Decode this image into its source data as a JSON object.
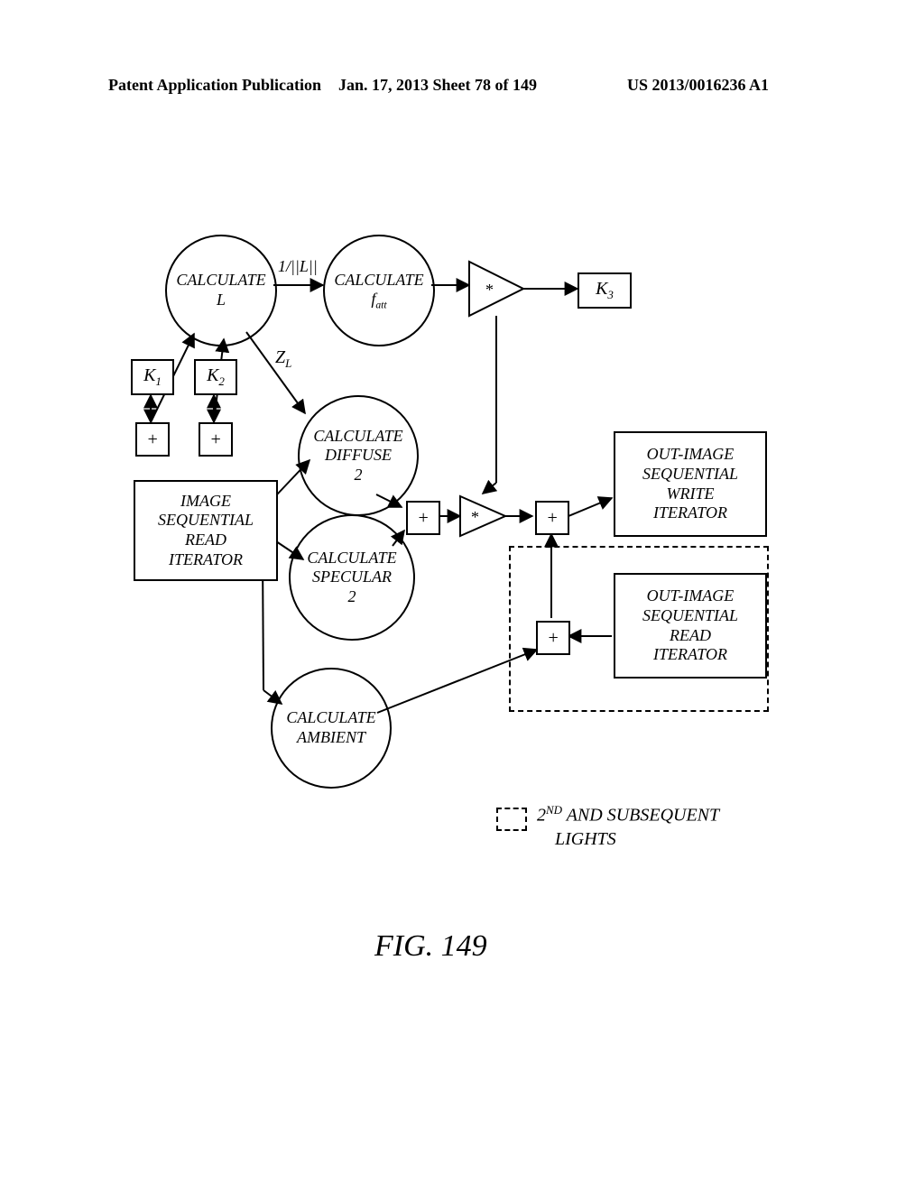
{
  "header": {
    "left": "Patent Application Publication",
    "mid": "Jan. 17, 2013  Sheet 78 of 149",
    "right": "US 2013/0016236 A1"
  },
  "nodes": {
    "calc_L": "CALCULATE\nL",
    "calc_fatt_1": "CALCULATE",
    "calc_fatt_2": "f",
    "calc_fatt_2_sub": "att",
    "calc_diff": "CALCULATE\nDIFFUSE\n2",
    "calc_spec": "CALCULATE\nSPECULAR\n2",
    "calc_amb": "CALCULATE\nAMBIENT",
    "image_read": "IMAGE\nSEQUENTIAL\nREAD\nITERATOR",
    "out_write": "OUT-IMAGE\nSEQUENTIAL\nWRITE\nITERATOR",
    "out_read": "OUT-IMAGE\nSEQUENTIAL\nREAD\nITERATOR",
    "K1": "K",
    "K1_sub": "1",
    "K2": "K",
    "K2_sub": "2",
    "K3": "K",
    "K3_sub": "3",
    "plus": "+",
    "star": "*",
    "label_1L": "1/||L||",
    "label_ZL_pre": "Z",
    "label_ZL_sub": "L",
    "legend": "2",
    "legend_sup": "ND",
    "legend_rest": " AND SUBSEQUENT",
    "legend_line2": "LIGHTS"
  },
  "figure_caption": "FIG. 149"
}
